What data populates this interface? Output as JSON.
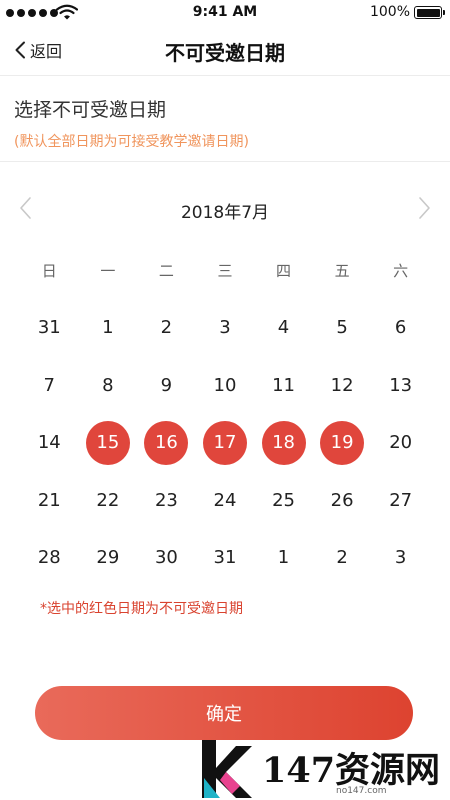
{
  "status_bar": {
    "time": "9:41 AM",
    "battery": "100%"
  },
  "nav": {
    "back_label": "返回",
    "title": "不可受邀日期"
  },
  "section": {
    "title": "选择不可受邀日期",
    "subtitle": "(默认全部日期为可接受教学邀请日期)"
  },
  "calendar": {
    "month_label": "2018年7月",
    "weekdays": [
      "日",
      "一",
      "二",
      "三",
      "四",
      "五",
      "六"
    ],
    "weeks": [
      [
        "31",
        "1",
        "2",
        "3",
        "4",
        "5",
        "6"
      ],
      [
        "7",
        "8",
        "9",
        "10",
        "11",
        "12",
        "13"
      ],
      [
        "14",
        "15",
        "16",
        "17",
        "18",
        "19",
        "20"
      ],
      [
        "21",
        "22",
        "23",
        "24",
        "25",
        "26",
        "27"
      ],
      [
        "28",
        "29",
        "30",
        "31",
        "1",
        "2",
        "3"
      ]
    ],
    "selected": [
      "15",
      "16",
      "17",
      "18",
      "19"
    ]
  },
  "note": "*选中的红色日期为不可受邀日期",
  "confirm_label": "确定",
  "watermark": {
    "text": "147资源网",
    "url": "no147.com"
  },
  "colors": {
    "accent": "#e0463c",
    "hint": "#f0955d"
  }
}
